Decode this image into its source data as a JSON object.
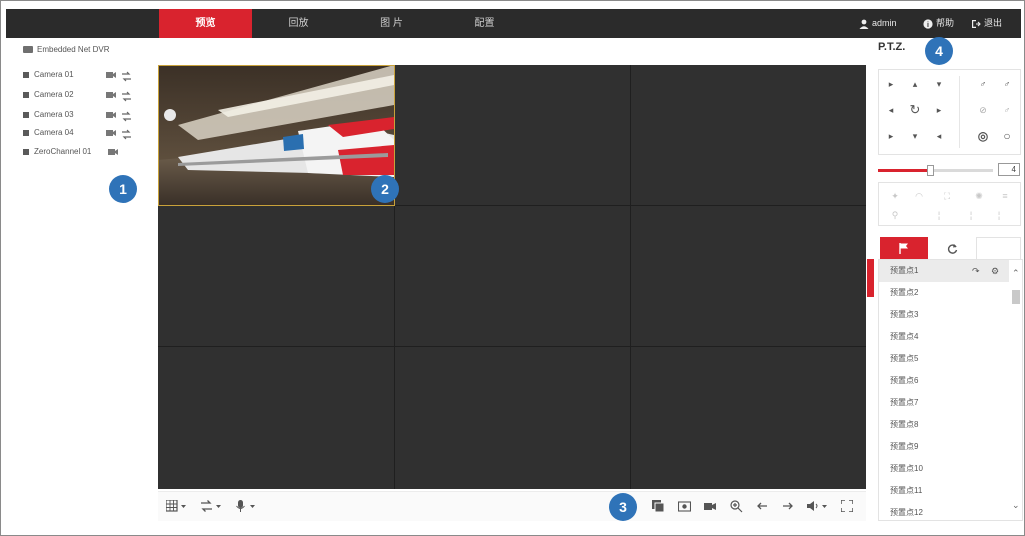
{
  "nav": {
    "tabs": [
      {
        "label": "预览"
      },
      {
        "label": "回放"
      },
      {
        "label": "图 片"
      },
      {
        "label": "配置"
      }
    ],
    "user": "admin",
    "help": "帮助",
    "logout": "退出"
  },
  "tree": {
    "root": "Embedded Net DVR",
    "cameras": [
      "Camera 01",
      "Camera 02",
      "Camera 03",
      "Camera 04"
    ],
    "zero_channel": "ZeroChannel 01"
  },
  "badges": [
    "1",
    "2",
    "3",
    "4"
  ],
  "ptz": {
    "title": "P.T.Z.",
    "speed": "4",
    "speed_level": 0.45,
    "presets": [
      "预置点1",
      "预置点2",
      "预置点3",
      "预置点4",
      "预置点5",
      "预置点6",
      "预置点7",
      "预置点8",
      "预置点9",
      "预置点10",
      "预置点11",
      "预置点12"
    ]
  },
  "colors": {
    "accent": "#d9232e",
    "topbar": "#2b2b2b",
    "badge": "#2f73b8",
    "video_bg": "#303030"
  }
}
